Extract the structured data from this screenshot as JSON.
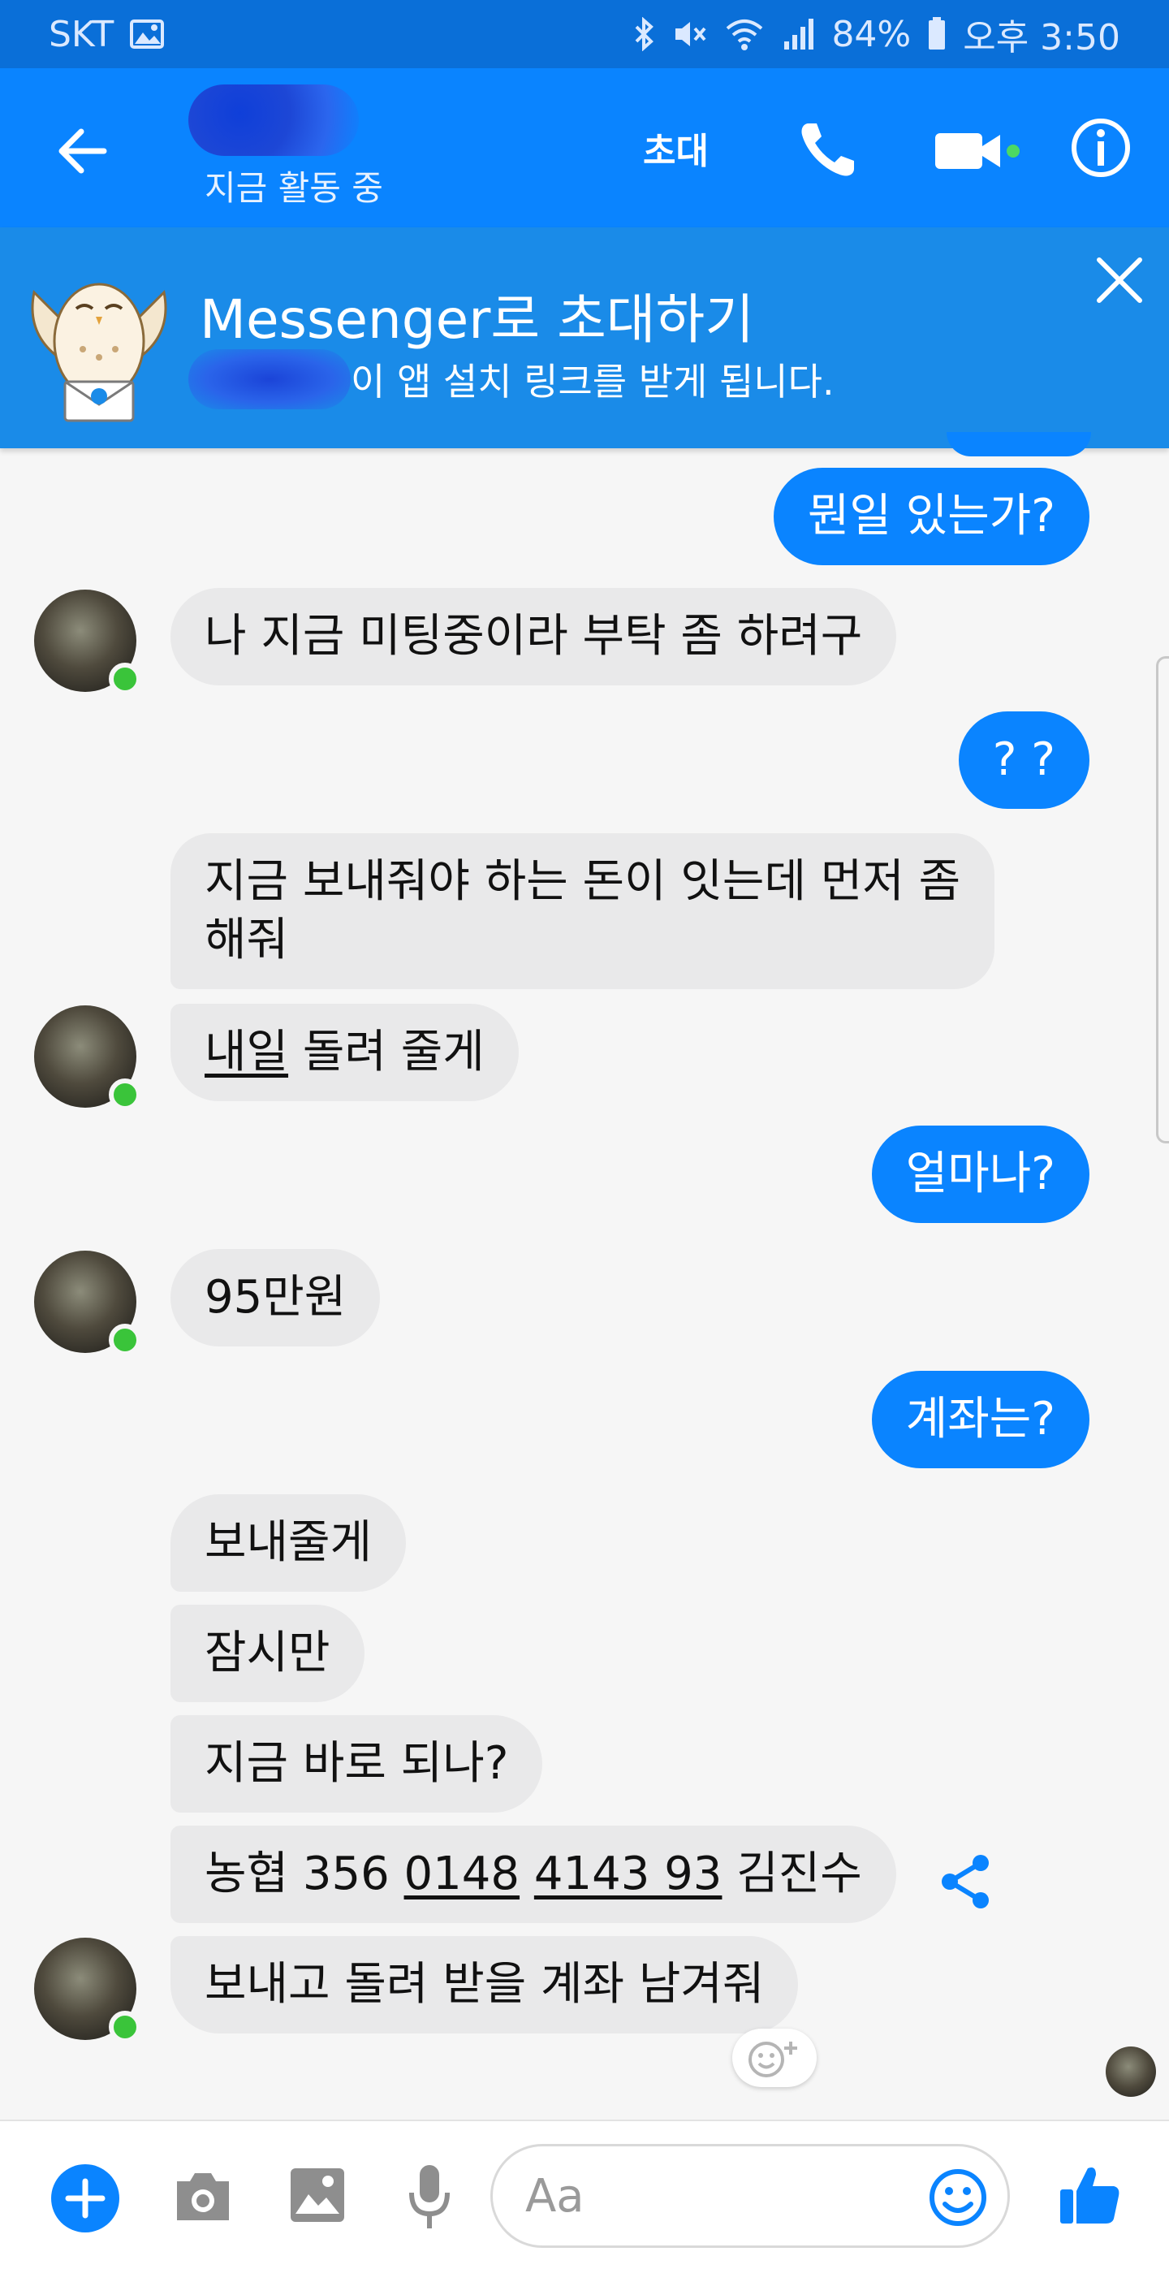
{
  "status_bar": {
    "carrier": "SKT",
    "battery": "84%",
    "time": "오후 3:50"
  },
  "header": {
    "status": "지금 활동 중",
    "invite_label": "초대"
  },
  "banner": {
    "title": "Messenger로 초대하기",
    "subtitle": "이 앱 설치 링크를 받게 됩니다."
  },
  "messages": {
    "m1": "뭔일 있는가?",
    "m2": "나 지금 미팅중이라 부탁 좀 하려구",
    "m3": "? ?",
    "m4_line1": "지금 보내줘야 하는 돈이 잇는데 먼저 좀",
    "m4_line2": "해줘",
    "m5_a": "내일",
    "m5_b": " 돌려 줄게",
    "m6": "얼마나?",
    "m7": "95만원",
    "m8": "계좌는?",
    "m9": "보내줄게",
    "m10": "잠시만",
    "m11": "지금 바로 되나?",
    "m12_a": "농협 356 ",
    "m12_b": "0148",
    "m12_c": " ",
    "m12_d": "4143 93",
    "m12_e": " 김진수",
    "m13": "보내고 돌려 받을 계좌 남겨줘"
  },
  "composer": {
    "placeholder": "Aa"
  },
  "colors": {
    "accent": "#0a84ff",
    "header": "#0a84ff",
    "banner": "#1a8be8",
    "incoming_bubble": "#e9e9ea",
    "online": "#3ac43a"
  }
}
